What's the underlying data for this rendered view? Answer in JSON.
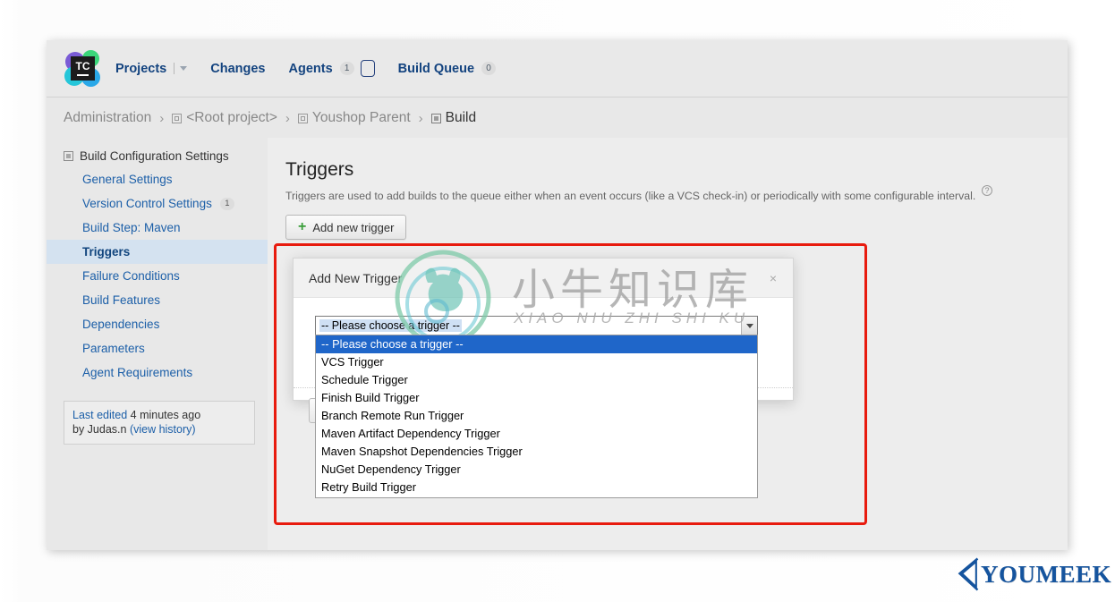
{
  "topnav": {
    "logo_text": "TC",
    "items": [
      {
        "label": "Projects",
        "has_dropdown": true,
        "badge": null
      },
      {
        "label": "Changes",
        "has_dropdown": false,
        "badge": null
      },
      {
        "label": "Agents",
        "has_dropdown": false,
        "badge": "1"
      },
      {
        "label": "Build Queue",
        "has_dropdown": false,
        "badge": "0"
      }
    ]
  },
  "breadcrumb": {
    "items": [
      {
        "label": "Administration",
        "icon": null
      },
      {
        "label": "<Root project>",
        "icon": "project-icon"
      },
      {
        "label": "Youshop Parent",
        "icon": "project-icon"
      },
      {
        "label": "Build",
        "icon": "build-icon"
      }
    ],
    "separator": "›"
  },
  "sidebar": {
    "heading": "Build Configuration Settings",
    "items": [
      {
        "label": "General Settings",
        "badge": null,
        "active": false
      },
      {
        "label": "Version Control Settings",
        "badge": "1",
        "active": false
      },
      {
        "label": "Build Step: Maven",
        "badge": null,
        "active": false
      },
      {
        "label": "Triggers",
        "badge": null,
        "active": true
      },
      {
        "label": "Failure Conditions",
        "badge": null,
        "active": false
      },
      {
        "label": "Build Features",
        "badge": null,
        "active": false
      },
      {
        "label": "Dependencies",
        "badge": null,
        "active": false
      },
      {
        "label": "Parameters",
        "badge": null,
        "active": false
      },
      {
        "label": "Agent Requirements",
        "badge": null,
        "active": false
      }
    ],
    "last_edited": {
      "label": "Last edited",
      "time": " 4 minutes ago",
      "by": "by Judas.n ",
      "history_link": "(view history)"
    }
  },
  "content": {
    "title": "Triggers",
    "description": "Triggers are used to add builds to the queue either when an event occurs (like a VCS check-in) or periodically with some configurable interval.",
    "help_icon": "?",
    "add_button": "Add new trigger",
    "add_button_plus": "+"
  },
  "dialog": {
    "title": "Add New Trigger",
    "close_label": "×",
    "select": {
      "value": "-- Please choose a trigger --",
      "options": [
        "-- Please choose a trigger --",
        "VCS Trigger",
        "Schedule Trigger",
        "Finish Build Trigger",
        "Branch Remote Run Trigger",
        "Maven Artifact Dependency Trigger",
        "Maven Snapshot Dependencies Trigger",
        "NuGet Dependency Trigger",
        "Retry Build Trigger"
      ],
      "selected_index": 0
    }
  },
  "watermark": {
    "cn": "小牛知识库",
    "pinyin": "XIAO NIU ZHI SHI KU"
  },
  "branding": {
    "youmeek": "YOUMEEK"
  },
  "colors": {
    "accent": "#13437f",
    "link": "#1c5fa8",
    "annotation": "#e81b0e",
    "dropdown_selected": "#1f66c9"
  }
}
